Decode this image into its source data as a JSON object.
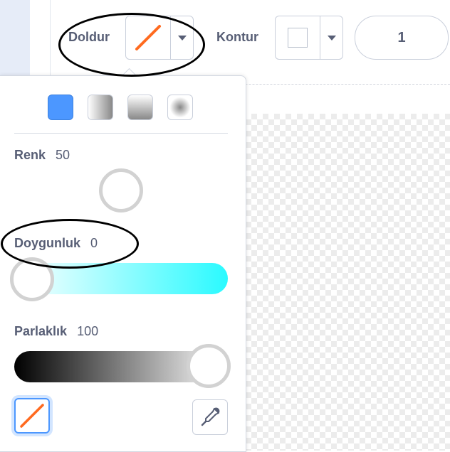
{
  "toolbar": {
    "fill_label": "Doldur",
    "outline_label": "Kontur",
    "outline_width_value": "1",
    "fill_icon": "diagonal-line-icon",
    "fill_color": "#ff6a1f"
  },
  "fill_picker": {
    "gradient_types": [
      {
        "name": "solid",
        "selected": true
      },
      {
        "name": "horizontal-gradient",
        "selected": false
      },
      {
        "name": "vertical-gradient",
        "selected": false
      },
      {
        "name": "radial-gradient",
        "selected": false
      }
    ],
    "sliders": {
      "color": {
        "label": "Renk",
        "value": "50"
      },
      "saturation": {
        "label": "Doygunluk",
        "value": "0"
      },
      "brightness": {
        "label": "Parlaklık",
        "value": "100"
      }
    },
    "swap_icon": "diagonal-line-icon",
    "eyedropper_icon": "eyedropper-icon"
  },
  "colors": {
    "accent": "#4c97ff",
    "selected_swatch": "#4c97ff",
    "saturation_end": "#2afaff",
    "text": "#575e75"
  }
}
